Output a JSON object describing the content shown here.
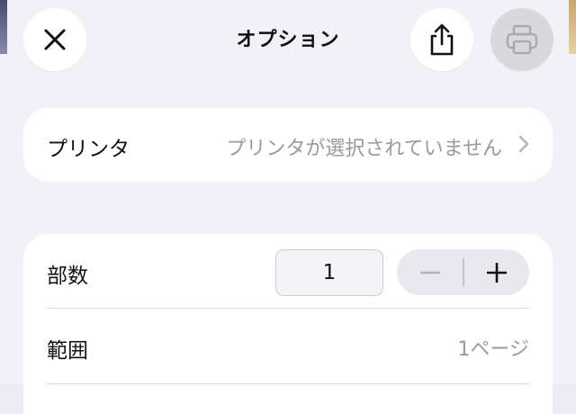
{
  "header": {
    "title": "オプション",
    "close_icon": "close-icon",
    "share_icon": "share-icon",
    "print_icon": "printer-icon"
  },
  "printer": {
    "label": "プリンタ",
    "value": "プリンタが選択されていません",
    "chevron_icon": "chevron-right-icon"
  },
  "options": {
    "copies_label": "部数",
    "copies_value": "1",
    "decrement_icon": "minus-icon",
    "increment_icon": "plus-icon",
    "range_label": "範囲",
    "range_value": "1ページ"
  },
  "colors": {
    "background": "#f2f1f7",
    "card": "#ffffff",
    "secondary_text": "#9a99a0",
    "disabled_button": "#d9d8dd"
  }
}
